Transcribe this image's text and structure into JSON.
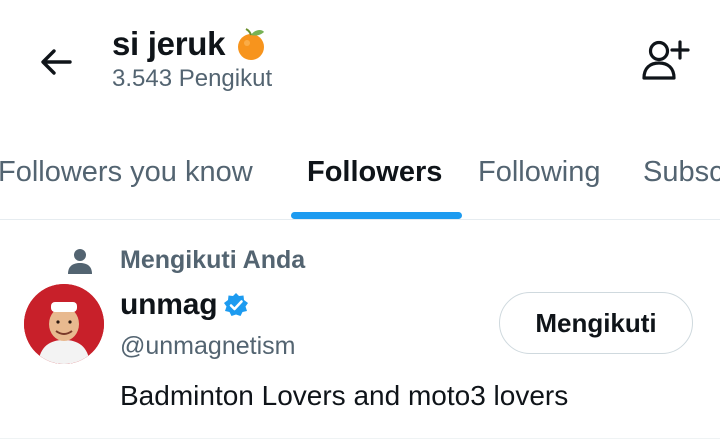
{
  "header": {
    "title": "si jeruk",
    "title_emoji_icon": "tangerine-icon",
    "subtitle": "3.543 Pengikut",
    "back_icon": "arrow-left-icon",
    "add_user_icon": "add-user-icon"
  },
  "tabs": [
    {
      "label": "Followers you know",
      "active": false
    },
    {
      "label": "Followers",
      "active": true
    },
    {
      "label": "Following",
      "active": false
    },
    {
      "label": "Subscriptions",
      "active": false
    }
  ],
  "user": {
    "follows_you_label": "Mengikuti Anda",
    "name": "unmag",
    "verified": true,
    "handle": "@unmagnetism",
    "bio": "Badminton Lovers and moto3 lovers",
    "follow_button_label": "Mengikuti"
  },
  "colors": {
    "accent": "#1d9bf0",
    "secondary_text": "#536471",
    "primary_text": "#0f1419",
    "avatar_bg": "#c8202a"
  }
}
